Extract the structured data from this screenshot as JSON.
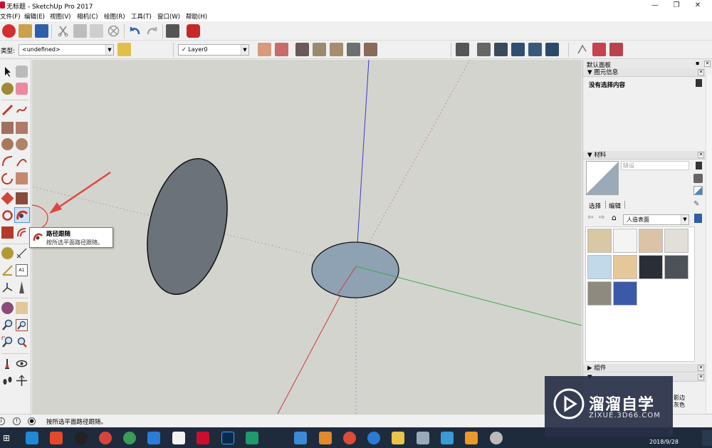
{
  "window": {
    "title": "无标题 - SketchUp Pro 2017",
    "minimize": "—",
    "maximize": "❐",
    "close": "✕"
  },
  "menu": [
    "文件(F)",
    "编辑(E)",
    "视图(V)",
    "相机(C)",
    "绘图(R)",
    "工具(T)",
    "窗口(W)",
    "帮助(H)"
  ],
  "toolbar2": {
    "type_label": "类型:",
    "type_value": "<undefined>",
    "layer_value": "Layer0"
  },
  "tooltip": {
    "title": "路径跟随",
    "description": "按所选平面路径跟随。"
  },
  "tray": {
    "title": "默认面板",
    "entity_info": {
      "header": "图元信息",
      "content": "没有选择内容"
    },
    "materials": {
      "header": "材料",
      "name_placeholder": "缺设",
      "tab_select": "选择",
      "tab_edit": "编辑",
      "collection": "人造表面",
      "swatch_colors": [
        "#d9c7a6",
        "#f4f4f2",
        "#dcc3a8",
        "#e2ded8",
        "#c2d9ea",
        "#e4c89a",
        "#2a2e36",
        "#4c5258",
        "#8f8a80",
        "#3a5aa8"
      ]
    },
    "components": {
      "header": "组件"
    },
    "partial_texts": [
      "影边",
      "灰色"
    ]
  },
  "status": {
    "text": "按所选平面路径跟随。"
  },
  "taskbar": {
    "time": "5",
    "date": "2018/9/28"
  },
  "watermark": {
    "cn": "溜溜自学",
    "en": "ZIXUE.3D66.COM"
  },
  "colors": {
    "viewport_bg": "#d4d4cf",
    "axis_red": "#c83c3c",
    "axis_green": "#3fa83f",
    "axis_blue": "#3a3ac8",
    "face_vertical": "#6b7279",
    "face_horizontal": "#8fa2b4"
  }
}
